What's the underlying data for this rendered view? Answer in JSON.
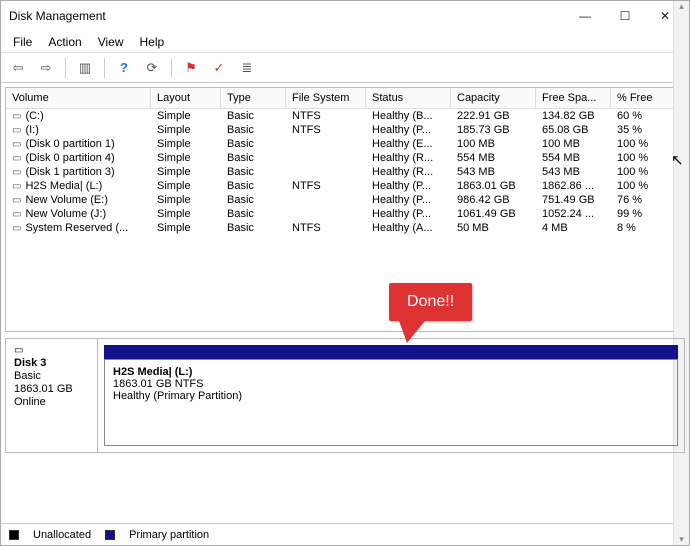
{
  "window": {
    "title": "Disk Management"
  },
  "menu": {
    "file": "File",
    "action": "Action",
    "view": "View",
    "help": "Help"
  },
  "columns": {
    "volume": "Volume",
    "layout": "Layout",
    "type": "Type",
    "filesystem": "File System",
    "status": "Status",
    "capacity": "Capacity",
    "freespace": "Free Spa...",
    "pctfree": "% Free"
  },
  "volumes": [
    {
      "name": "(C:)",
      "layout": "Simple",
      "type": "Basic",
      "fs": "NTFS",
      "status": "Healthy (B...",
      "capacity": "222.91 GB",
      "free": "134.82 GB",
      "pct": "60 %"
    },
    {
      "name": "(I:)",
      "layout": "Simple",
      "type": "Basic",
      "fs": "NTFS",
      "status": "Healthy (P...",
      "capacity": "185.73 GB",
      "free": "65.08 GB",
      "pct": "35 %"
    },
    {
      "name": "(Disk 0 partition 1)",
      "layout": "Simple",
      "type": "Basic",
      "fs": "",
      "status": "Healthy (E...",
      "capacity": "100 MB",
      "free": "100 MB",
      "pct": "100 %"
    },
    {
      "name": "(Disk 0 partition 4)",
      "layout": "Simple",
      "type": "Basic",
      "fs": "",
      "status": "Healthy (R...",
      "capacity": "554 MB",
      "free": "554 MB",
      "pct": "100 %"
    },
    {
      "name": "(Disk 1 partition 3)",
      "layout": "Simple",
      "type": "Basic",
      "fs": "",
      "status": "Healthy (R...",
      "capacity": "543 MB",
      "free": "543 MB",
      "pct": "100 %"
    },
    {
      "name": "H2S Media| (L:)",
      "layout": "Simple",
      "type": "Basic",
      "fs": "NTFS",
      "status": "Healthy (P...",
      "capacity": "1863.01 GB",
      "free": "1862.86 ...",
      "pct": "100 %"
    },
    {
      "name": "New Volume (E:)",
      "layout": "Simple",
      "type": "Basic",
      "fs": "",
      "status": "Healthy (P...",
      "capacity": "986.42 GB",
      "free": "751.49 GB",
      "pct": "76 %"
    },
    {
      "name": "New Volume (J:)",
      "layout": "Simple",
      "type": "Basic",
      "fs": "",
      "status": "Healthy (P...",
      "capacity": "1061.49 GB",
      "free": "1052.24 ...",
      "pct": "99 %"
    },
    {
      "name": "System Reserved (...",
      "layout": "Simple",
      "type": "Basic",
      "fs": "NTFS",
      "status": "Healthy (A...",
      "capacity": "50 MB",
      "free": "4 MB",
      "pct": "8 %"
    }
  ],
  "disk": {
    "label": "Disk 3",
    "type": "Basic",
    "size": "1863.01 GB",
    "state": "Online",
    "partition": {
      "name": "H2S Media|  (L:)",
      "desc": "1863.01 GB NTFS",
      "status": "Healthy (Primary Partition)"
    }
  },
  "legend": {
    "unallocated": "Unallocated",
    "primary": "Primary partition"
  },
  "callout": {
    "text": "Done!!"
  }
}
